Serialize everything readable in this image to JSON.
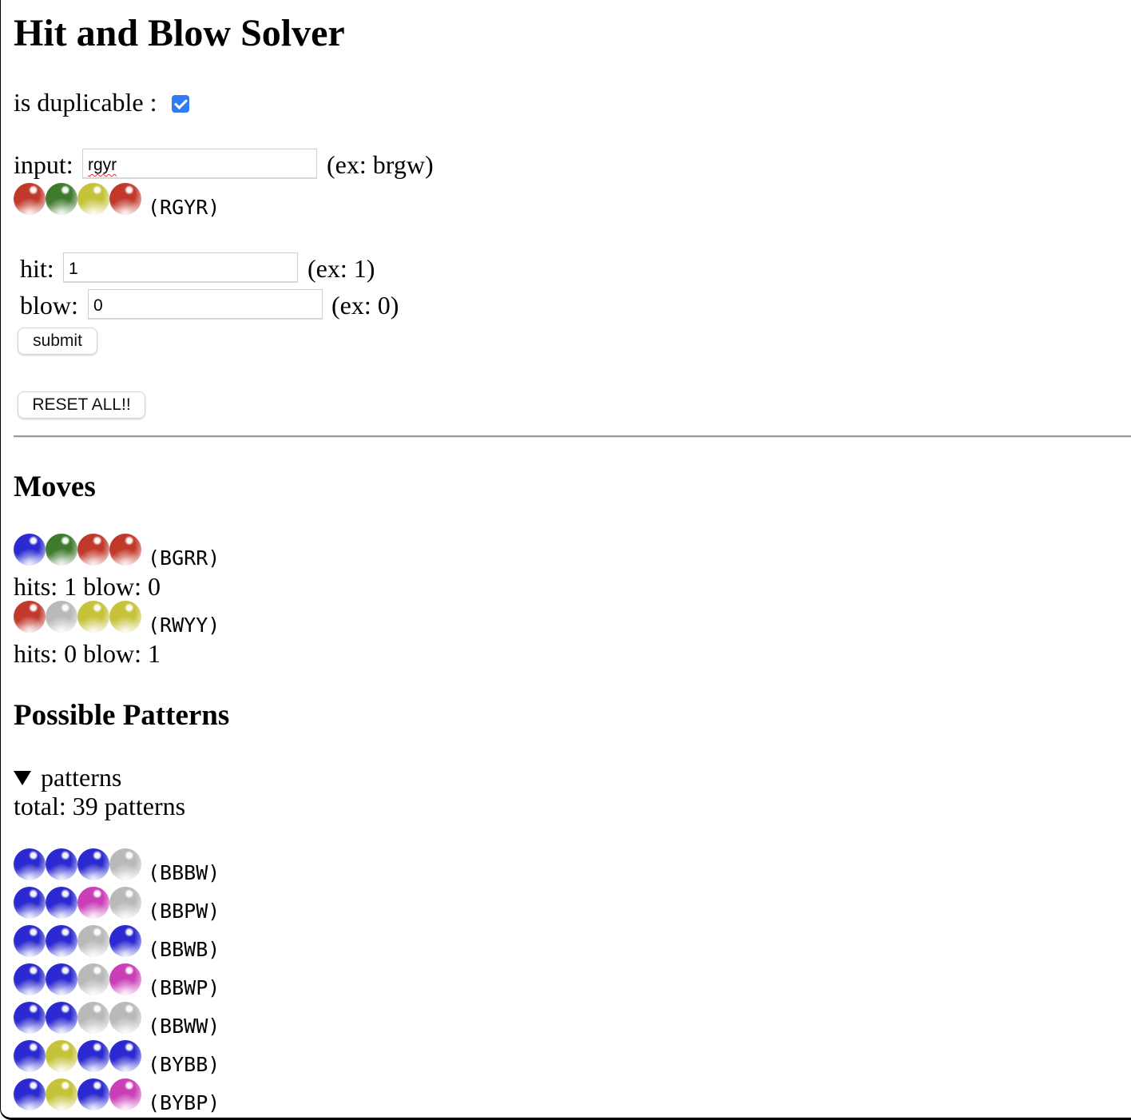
{
  "title": "Hit and Blow Solver",
  "duplicable": {
    "label": "is duplicable :",
    "checked": true
  },
  "input": {
    "label": "input:",
    "value": "rgyr",
    "hint": "(ex: brgw)",
    "preview_code": "(RGYR)",
    "preview_colors": [
      "R",
      "G",
      "Y",
      "R"
    ]
  },
  "hit": {
    "label": "hit:",
    "value": "1",
    "hint": "(ex: 1)"
  },
  "blow": {
    "label": "blow:",
    "value": "0",
    "hint": "(ex: 0)"
  },
  "submit_label": "submit",
  "reset_label": "RESET ALL!!",
  "moves": {
    "heading": "Moves",
    "items": [
      {
        "colors": [
          "B",
          "G",
          "R",
          "R"
        ],
        "code": "(BGRR)",
        "result": "hits: 1 blow: 0"
      },
      {
        "colors": [
          "R",
          "W",
          "Y",
          "Y"
        ],
        "code": "(RWYY)",
        "result": "hits: 0 blow: 1"
      }
    ]
  },
  "possible": {
    "heading": "Possible Patterns",
    "summary_label": "patterns",
    "total": "total: 39 patterns",
    "patterns": [
      {
        "colors": [
          "B",
          "B",
          "B",
          "W"
        ],
        "code": "(BBBW)"
      },
      {
        "colors": [
          "B",
          "B",
          "P",
          "W"
        ],
        "code": "(BBPW)"
      },
      {
        "colors": [
          "B",
          "B",
          "W",
          "B"
        ],
        "code": "(BBWB)"
      },
      {
        "colors": [
          "B",
          "B",
          "W",
          "P"
        ],
        "code": "(BBWP)"
      },
      {
        "colors": [
          "B",
          "B",
          "W",
          "W"
        ],
        "code": "(BBWW)"
      },
      {
        "colors": [
          "B",
          "Y",
          "B",
          "B"
        ],
        "code": "(BYBB)"
      },
      {
        "colors": [
          "B",
          "Y",
          "B",
          "P"
        ],
        "code": "(BYBP)"
      }
    ]
  },
  "ball_colors": {
    "R": "#c0392b",
    "G": "#3f7a2e",
    "Y": "#c6c23a",
    "B": "#2a2ad0",
    "W": "#b9b9b9",
    "P": "#c93fb6"
  }
}
